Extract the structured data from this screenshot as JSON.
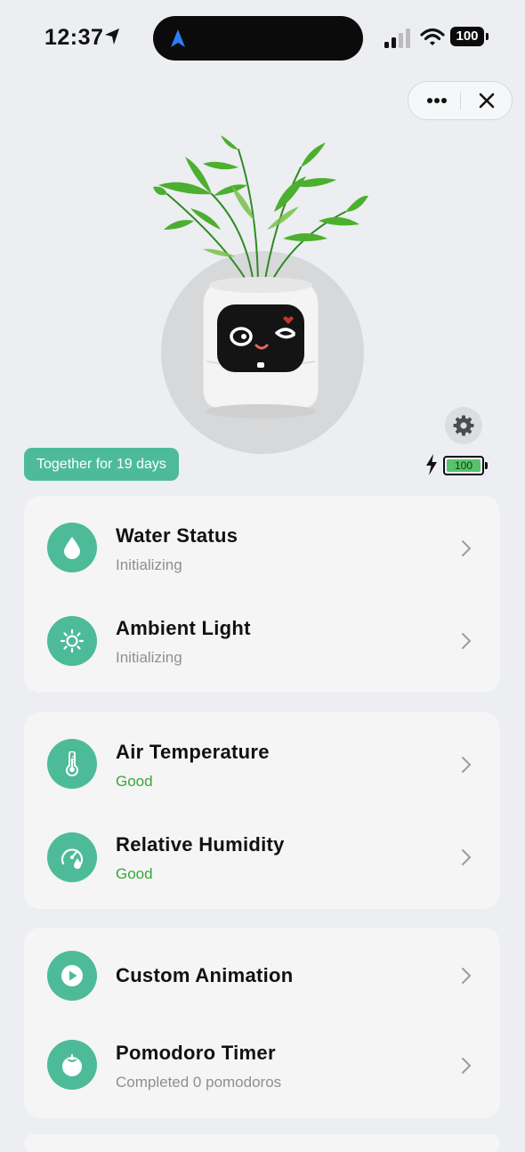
{
  "status_bar": {
    "time": "12:37",
    "battery": "100"
  },
  "capsule": {
    "more_label": "•••"
  },
  "device": {
    "together_text": "Together for 19 days",
    "battery_level": "100"
  },
  "colors": {
    "accent": "#4dbb98",
    "good": "#3aa63a",
    "muted": "#8d8f92"
  },
  "cards": [
    {
      "rows": [
        {
          "icon": "water-drop-icon",
          "title": "Water Status",
          "subtitle": "Initializing",
          "state": "neutral"
        },
        {
          "icon": "sun-icon",
          "title": "Ambient Light",
          "subtitle": "Initializing",
          "state": "neutral"
        }
      ]
    },
    {
      "rows": [
        {
          "icon": "thermometer-icon",
          "title": "Air Temperature",
          "subtitle": "Good",
          "state": "good"
        },
        {
          "icon": "humidity-gauge-icon",
          "title": "Relative Humidity",
          "subtitle": "Good",
          "state": "good"
        }
      ]
    },
    {
      "rows": [
        {
          "icon": "play-icon",
          "title": "Custom Animation",
          "subtitle": "",
          "state": "neutral"
        },
        {
          "icon": "tomato-icon",
          "title": "Pomodoro Timer",
          "subtitle": "Completed 0 pomodoros",
          "state": "neutral"
        }
      ]
    }
  ]
}
